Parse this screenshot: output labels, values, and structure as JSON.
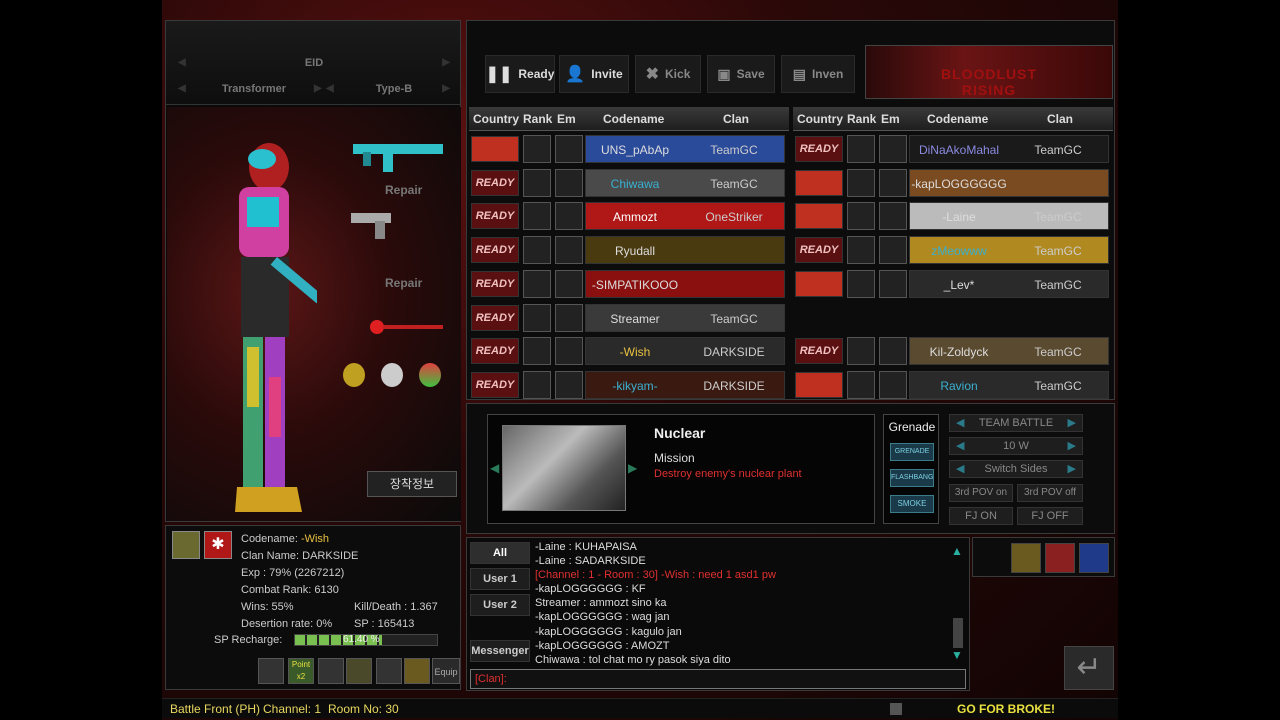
{
  "loadout": {
    "row1": "EID",
    "row2_left": "Transformer",
    "row2_right": "Type-B",
    "repair1": "Repair",
    "repair2": "Repair",
    "info_button": "장착정보"
  },
  "profile": {
    "codename_label": "Codename:",
    "codename": "-Wish",
    "clan_label": "Clan Name:",
    "clan": "DARKSIDE",
    "exp": "Exp : 79% (2267212)",
    "combat_rank": "Combat Rank: 6130",
    "wins": "Wins: 55%",
    "kill_death": "Kill/Death : 1.367",
    "desertion": "Desertion rate: 0%",
    "sp": "SP : 165413",
    "sp_recharge_label": "SP Recharge:",
    "sp_recharge_value": "61.40 %",
    "sp_recharge_fraction": 0.614,
    "point_badge": "Point x2",
    "equip_label": "Equip"
  },
  "toolbar": {
    "ready": "Ready",
    "invite": "Invite",
    "kick": "Kick",
    "save": "Save",
    "inven": "Inven"
  },
  "banner": {
    "line1": "BLOODLUST",
    "line2": "RISING"
  },
  "table_headers": {
    "country": "Country",
    "rank": "Rank",
    "em": "Em",
    "codename": "Codename",
    "clan": "Clan"
  },
  "team_left": [
    {
      "codename": "UNS_pAbAp",
      "clan": "TeamGC",
      "ready": "",
      "name_color": "#dddddd",
      "card": "#2a4a9a"
    },
    {
      "codename": "Chiwawa",
      "clan": "TeamGC",
      "ready": "READY",
      "name_color": "#3ab0d0",
      "card": "#4a4a4a"
    },
    {
      "codename": "Ammozt",
      "clan": "OneStriker",
      "ready": "READY",
      "name_color": "#ffffff",
      "card": "#b01818"
    },
    {
      "codename": "Ryudall",
      "clan": "",
      "ready": "READY",
      "name_color": "#dddddd",
      "card": "#4a3a10"
    },
    {
      "codename": "-SIMPATIKOOO",
      "clan": "",
      "ready": "READY",
      "name_color": "#dddddd",
      "card": "#8a1010"
    },
    {
      "codename": "Streamer",
      "clan": "TeamGC",
      "ready": "READY",
      "name_color": "#dddddd",
      "card": "#3a3a3a"
    },
    {
      "codename": "-Wish",
      "clan": "DARKSIDE",
      "ready": "READY",
      "name_color": "#e8c040",
      "card": "#2a2a2a"
    },
    {
      "codename": "-kikyam-",
      "clan": "DARKSIDE",
      "ready": "READY",
      "name_color": "#3ab0d0",
      "card": "#3a1a10"
    }
  ],
  "team_right": [
    {
      "codename": "DiNaAkoMahal",
      "clan": "TeamGC",
      "ready": "READY",
      "name_color": "#8a8ae0",
      "card": "#1a1a1a"
    },
    {
      "codename": "-kapLOGGGGGG",
      "clan": "",
      "ready": "",
      "name_color": "#dddddd",
      "card": "#7a4a20"
    },
    {
      "codename": "-Laine",
      "clan": "TeamGC",
      "ready": "",
      "name_color": "#dddddd",
      "card": "#bbbbbb"
    },
    {
      "codename": "zMeowww",
      "clan": "TeamGC",
      "ready": "READY",
      "name_color": "#3ab0d0",
      "card": "#b08a20"
    },
    {
      "codename": "_Lev*",
      "clan": "TeamGC",
      "ready": "",
      "name_color": "#dddddd",
      "card": "#2a2a2a"
    },
    {
      "codename": "",
      "clan": "",
      "ready": "",
      "name_color": "#dddddd",
      "card": "transparent"
    },
    {
      "codename": "Kil-Zoldyck",
      "clan": "TeamGC",
      "ready": "READY",
      "name_color": "#dddddd",
      "card": "#5a4a30"
    },
    {
      "codename": "Ravion",
      "clan": "TeamGC",
      "ready": "",
      "name_color": "#3ab0d0",
      "card": "#2a2a2a"
    }
  ],
  "map": {
    "name": "Nuclear",
    "mode": "Mission",
    "objective": "Destroy enemy's nuclear plant"
  },
  "grenade": {
    "title": "Grenade",
    "grenade": "GRENADE",
    "flashbang": "FLASHBANG",
    "smoke": "SMOKE"
  },
  "options": {
    "mode": "TEAM BATTLE",
    "win": "10 W",
    "switch": "Switch Sides",
    "pov_on": "3rd POV on",
    "pov_off": "3rd POV off",
    "fj_on": "FJ ON",
    "fj_off": "FJ OFF"
  },
  "chat": {
    "tabs": [
      "All",
      "User 1",
      "User 2",
      "Messenger"
    ],
    "lines": [
      {
        "text": "-Laine : KUHAPAISA",
        "sys": false
      },
      {
        "text": "-Laine : SADARKSIDE",
        "sys": false
      },
      {
        "text": "[Channel : 1 - Room : 30] -Wish : need 1 asd1 pw",
        "sys": true
      },
      {
        "text": "-kapLOGGGGGG : KF",
        "sys": false
      },
      {
        "text": "Streamer : ammozt sino ka",
        "sys": false
      },
      {
        "text": "-kapLOGGGGGG : wag jan",
        "sys": false
      },
      {
        "text": "-kapLOGGGGGG : kagulo jan",
        "sys": false
      },
      {
        "text": "-kapLOGGGGGG : AMOZT",
        "sys": false
      },
      {
        "text": "Chiwawa : tol chat mo ry pasok siya dito",
        "sys": false
      }
    ],
    "input_value": "[Clan]:"
  },
  "status": {
    "server": "Battle Front (PH)",
    "channel": "Channel: 1",
    "room": "Room No: 30",
    "slogan": "GO FOR BROKE!"
  }
}
